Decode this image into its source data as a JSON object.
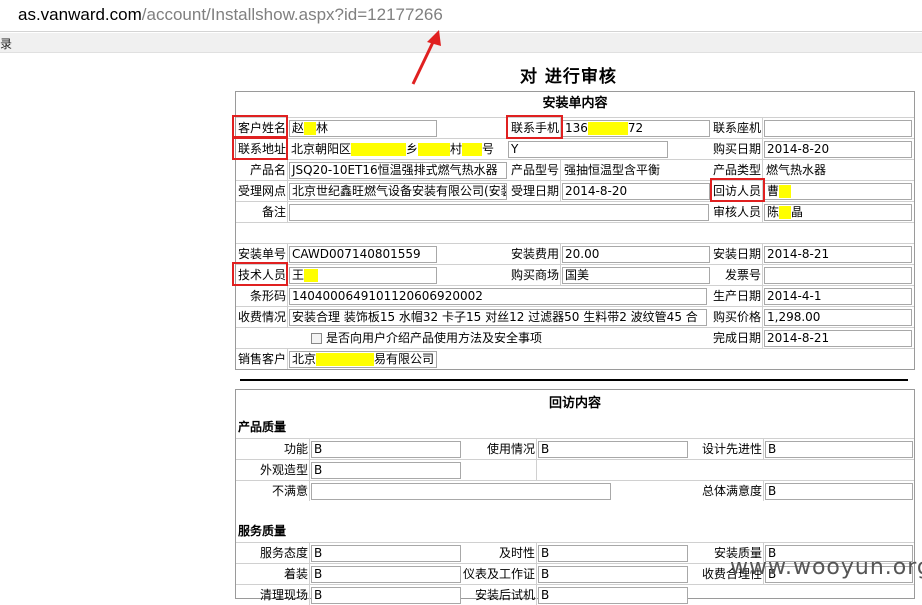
{
  "browser": {
    "url_host": "as.vanward.com",
    "url_path": "/account/Installshow.aspx?id=12177266",
    "menu_label": "录"
  },
  "page": {
    "title": "对 进行审核"
  },
  "install": {
    "title": "安装单内容",
    "customer_name_label": "客户姓名",
    "customer_name_a": "赵",
    "customer_name_b": "林",
    "phone_label": "联系手机",
    "phone_a": "136",
    "phone_b": "72",
    "landline_label": "联系座机",
    "landline": "",
    "address_label": "联系地址",
    "address_a": "北京朝阳区",
    "address_b": "乡",
    "address_c": "村",
    "address_d": "号",
    "address_extra": "Y",
    "buy_date_label": "购买日期",
    "buy_date": "2014-8-20",
    "product_name_label": "产品名",
    "product_name": "JSQ20-10ET16恒温强排式燃气热水器",
    "model_label": "产品型号",
    "model": "强抽恒温型含平衡",
    "product_type_label": "产品类型",
    "product_type": "燃气热水器",
    "outlet_label": "受理网点",
    "outlet": "北京世纪鑫旺燃气设备安装有限公司(安装",
    "accept_date_label": "受理日期",
    "accept_date": "2014-8-20",
    "visitor_label": "回访人员",
    "visitor": "曹",
    "remark_label": "备注",
    "remark": "",
    "auditor_label": "审核人员",
    "auditor_a": "陈",
    "auditor_b": "晶",
    "order_no_label": "安装单号",
    "order_no": "CAWD007140801559",
    "fee_label": "安装费用",
    "fee": "20.00",
    "install_date_label": "安装日期",
    "install_date": "2014-8-21",
    "tech_label": "技术人员",
    "tech": "王",
    "mall_label": "购买商场",
    "mall": "国美",
    "invoice_label": "发票号",
    "invoice": "",
    "barcode_label": "条形码",
    "barcode": "1404000649101120606920002",
    "prod_date_label": "生产日期",
    "prod_date": "2014-4-1",
    "charge_label": "收费情况",
    "charge": "安装合理 装饰板15 水帽32 卡子15 对丝12 过滤器50 生料带2 波纹管45 合",
    "price_label": "购买价格",
    "price": "1,298.00",
    "check_text": "是否向用户介绍产品使用方法及安全事项",
    "finish_date_label": "完成日期",
    "finish_date": "2014-8-21",
    "sales_label": "销售客户",
    "sales_a": "北京",
    "sales_b": "易有限公司"
  },
  "visit": {
    "title": "回访内容",
    "quality_head": "产品质量",
    "func_label": "功能",
    "func": "B",
    "usage_label": "使用情况",
    "usage": "B",
    "design_label": "设计先进性",
    "design": "B",
    "appearance_label": "外观造型",
    "appearance": "B",
    "unsatisfied_label": "不满意",
    "unsatisfied": "",
    "overall_label": "总体满意度",
    "overall": "B",
    "service_head": "服务质量",
    "attitude_label": "服务态度",
    "attitude": "B",
    "timely_label": "及时性",
    "timely": "B",
    "install_quality_label": "安装质量",
    "install_quality": "B",
    "dress_label": "着装",
    "dress": "B",
    "manner_label": "仪表及工作证",
    "manner": "B",
    "fee_reason_label": "收费合理性",
    "fee_reason": "B",
    "clean_label": "清理现场",
    "clean": "B",
    "test_label": "安装后试机",
    "test": "B"
  },
  "watermark": "www.wooyun.org",
  "colors": {
    "highlight": "#ffff00",
    "annotation": "#e02020"
  }
}
